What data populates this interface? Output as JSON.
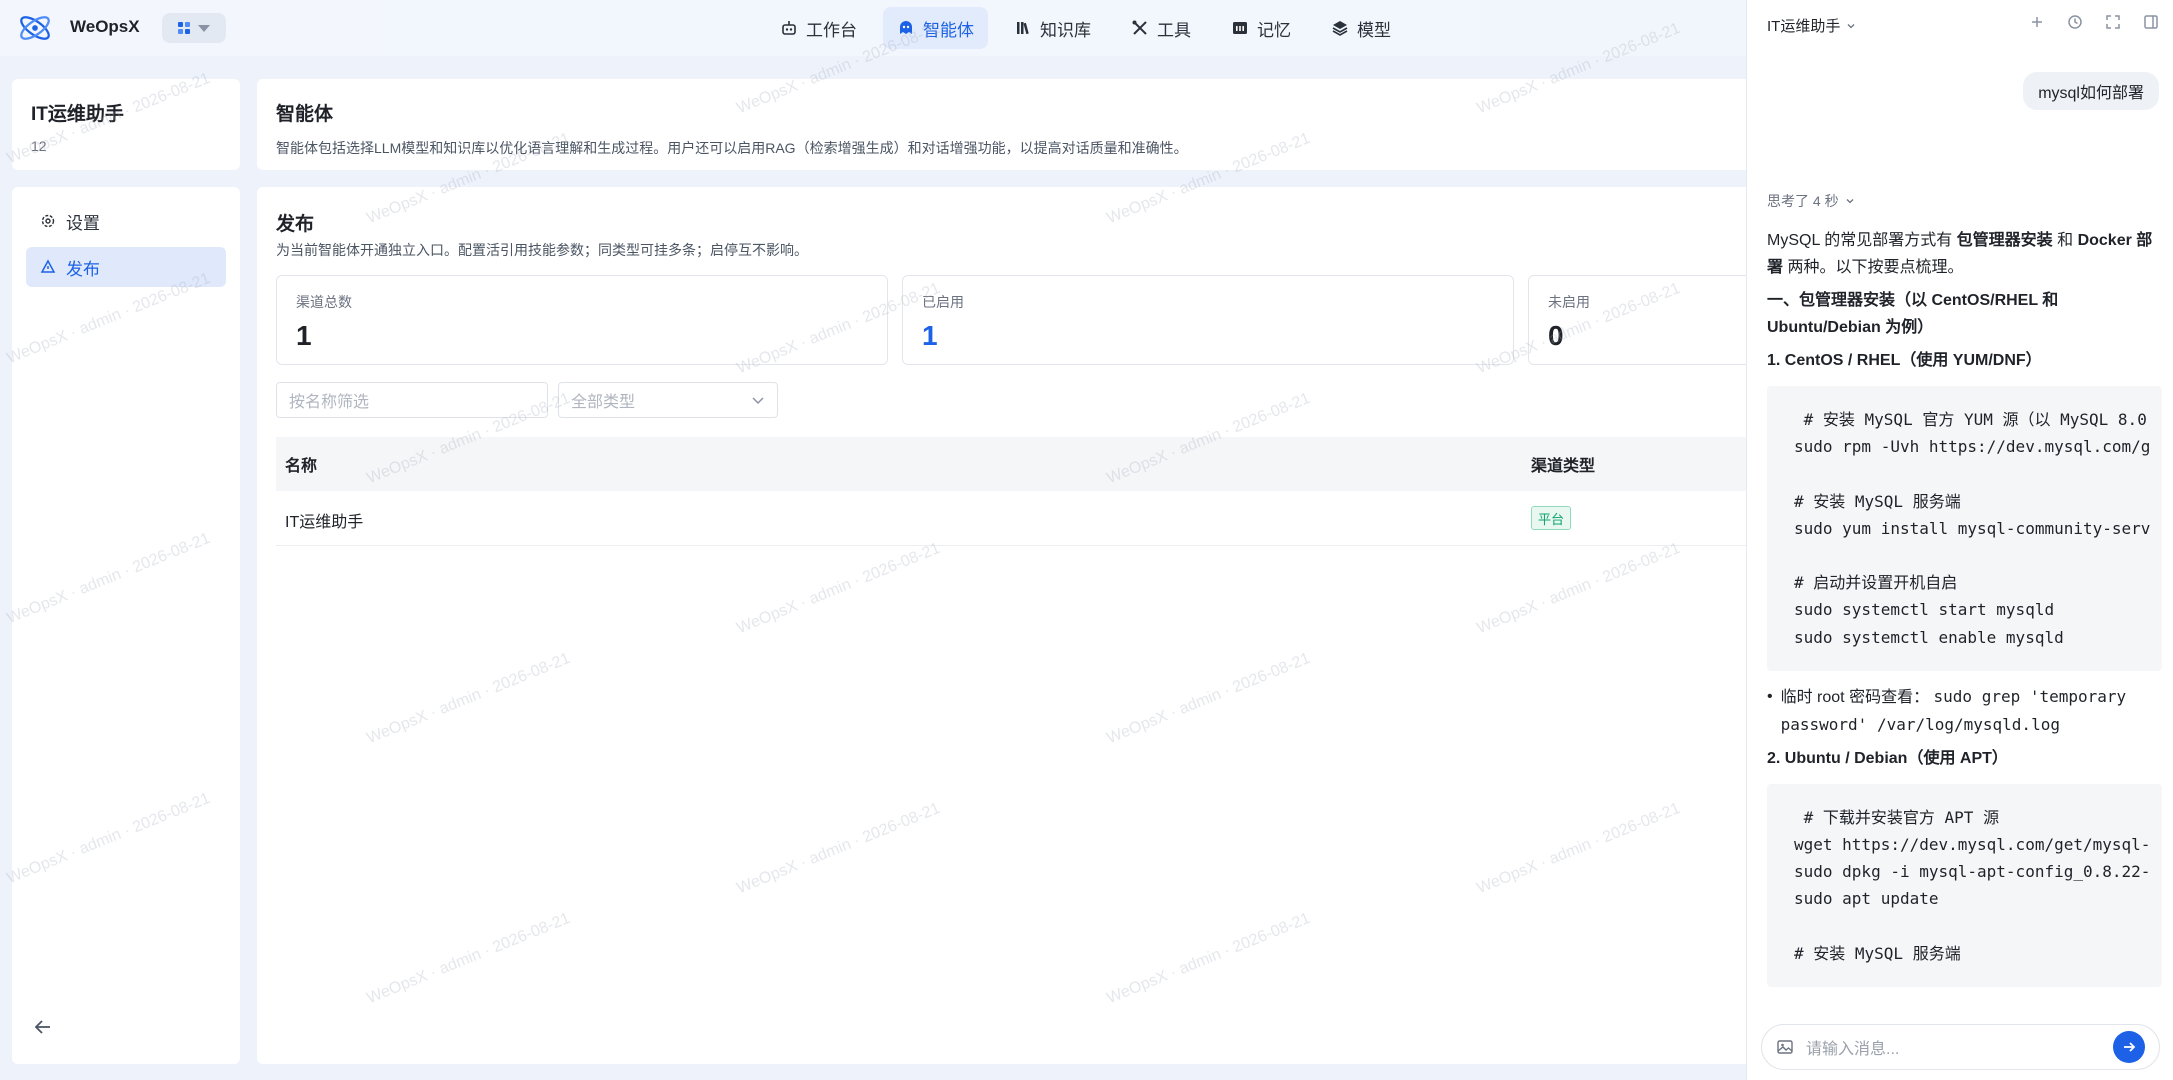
{
  "header": {
    "brand": "WeOpsX",
    "nav": [
      {
        "label": "工作台",
        "icon": "robot-icon",
        "active": false
      },
      {
        "label": "智能体",
        "icon": "agent-icon",
        "active": true
      },
      {
        "label": "知识库",
        "icon": "library-icon",
        "active": false
      },
      {
        "label": "工具",
        "icon": "tools-icon",
        "active": false
      },
      {
        "label": "记忆",
        "icon": "memory-icon",
        "active": false
      },
      {
        "label": "模型",
        "icon": "layers-icon",
        "active": false
      }
    ],
    "accent": "#1d62e6"
  },
  "sidebar": {
    "title": "IT运维助手",
    "subtitle": "12",
    "items": [
      {
        "label": "设置",
        "icon": "gear-icon",
        "active": false
      },
      {
        "label": "发布",
        "icon": "publish-icon",
        "active": true
      }
    ]
  },
  "intro": {
    "title": "智能体",
    "desc": "智能体包括选择LLM模型和知识库以优化语言理解和生成过程。用户还可以启用RAG（检索增强生成）和对话增强功能，以提高对话质量和准确性。"
  },
  "publish": {
    "title": "发布",
    "desc": "为当前智能体开通独立入口。配置活引用技能参数；同类型可挂多条；启停互不影响。",
    "stats": [
      {
        "label": "渠道总数",
        "value": "1"
      },
      {
        "label": "已启用",
        "value": "1"
      },
      {
        "label": "未启用",
        "value": "0"
      }
    ],
    "filter_placeholder": "按名称筛选",
    "type_select": "全部类型",
    "columns": [
      "名称",
      "渠道类型"
    ],
    "rows": [
      {
        "name": "IT运维助手",
        "type": "平台"
      }
    ]
  },
  "watermark": "WeOpsX · admin · 2026-08-21",
  "chat": {
    "title": "IT运维助手",
    "user_message": "mysql如何部署",
    "thinking": "思考了 4 秒",
    "answer": {
      "intro_a": "MySQL 的常见部署方式有 ",
      "intro_b": "包管理器安装",
      "intro_c": " 和 ",
      "intro_d": "Docker 部署",
      "intro_e": " 两种。以下按要点梳理。",
      "h1": "一、包管理器安装（以 CentOS/RHEL 和 Ubuntu/Debian 为例）",
      "h2": "1. CentOS / RHEL（使用 YUM/DNF）",
      "code1": " # 安装 MySQL 官方 YUM 源（以 MySQL 8.0\nsudo rpm -Uvh https://dev.mysql.com/g\n\n# 安装 MySQL 服务端\nsudo yum install mysql-community-serv\n\n# 启动并设置开机自启\nsudo systemctl start mysqld\nsudo systemctl enable mysqld",
      "bullet_text": "临时 root 密码查看：",
      "bullet_code": "sudo grep 'temporary password' /var/log/mysqld.log",
      "h3": "2. Ubuntu / Debian（使用 APT）",
      "code2": " # 下载并安装官方 APT 源\nwget https://dev.mysql.com/get/mysql-\nsudo dpkg -i mysql-apt-config_0.8.22-\nsudo apt update\n\n# 安装 MySQL 服务端"
    },
    "input_placeholder": "请输入消息..."
  }
}
